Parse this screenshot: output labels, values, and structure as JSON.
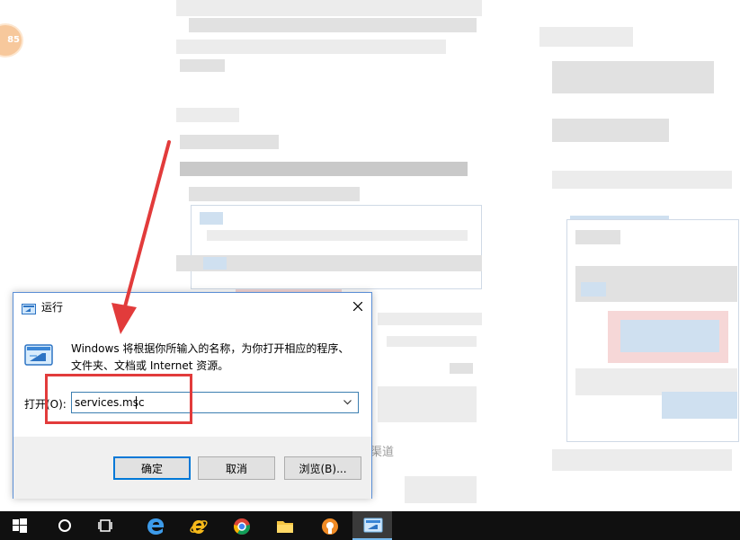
{
  "dialog": {
    "title": "运行",
    "close_label": "✕",
    "description_line1": "Windows 将根据你所输入的名称，为你打开相应的程序、",
    "description_line2": "文件夹、文档或 Internet 资源。",
    "open_label": "打开(O):",
    "open_value": "services.msc",
    "buttons": {
      "ok": "确定",
      "cancel": "取消",
      "browse": "浏览(B)..."
    }
  },
  "background": {
    "badge": "85",
    "partial_text": "渠道"
  },
  "taskbar": {
    "items": [
      "windows-start-icon",
      "cortana-search-icon",
      "task-view-icon",
      "edge-browser-icon",
      "internet-explorer-icon",
      "chrome-browser-icon",
      "file-explorer-icon",
      "app-icon",
      "run-app-icon"
    ]
  },
  "colors": {
    "annotation": "#e23b3b",
    "taskbar": "#101010",
    "dialog_border": "#5b8fd6",
    "ok_focus": "#0078d7"
  }
}
